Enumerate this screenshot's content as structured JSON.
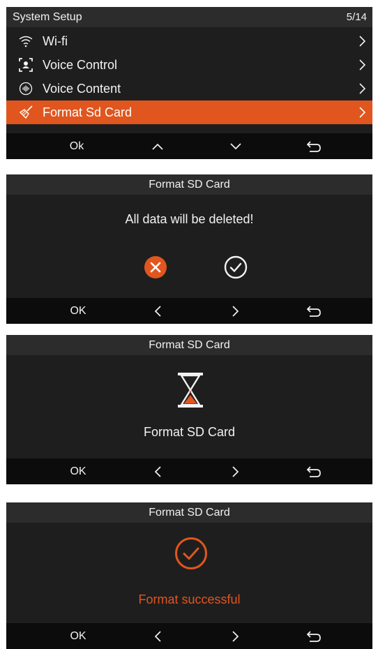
{
  "menu": {
    "title": "System Setup",
    "counter": "5/14",
    "items": [
      {
        "label": "Wi-fi",
        "icon": "wifi-icon"
      },
      {
        "label": "Voice Control",
        "icon": "voice-control-icon"
      },
      {
        "label": "Voice Content",
        "icon": "voice-content-icon"
      },
      {
        "label": "Format Sd Card",
        "icon": "broom-icon",
        "selected": true
      }
    ],
    "bar": {
      "ok": "Ok"
    }
  },
  "confirm": {
    "title": "Format SD Card",
    "message": "All data will be deleted!",
    "bar": {
      "ok": "OK"
    }
  },
  "progress": {
    "title": "Format SD Card",
    "message": "Format SD Card",
    "bar": {
      "ok": "OK"
    }
  },
  "success": {
    "title": "Format SD Card",
    "message": "Format successful",
    "bar": {
      "ok": "OK"
    }
  },
  "colors": {
    "accent": "#e0561e",
    "screen_bg": "#1e1e1e",
    "header_bg": "#2c2c2c",
    "bar_bg": "#0c0c0c",
    "text": "#f2f2f2"
  }
}
